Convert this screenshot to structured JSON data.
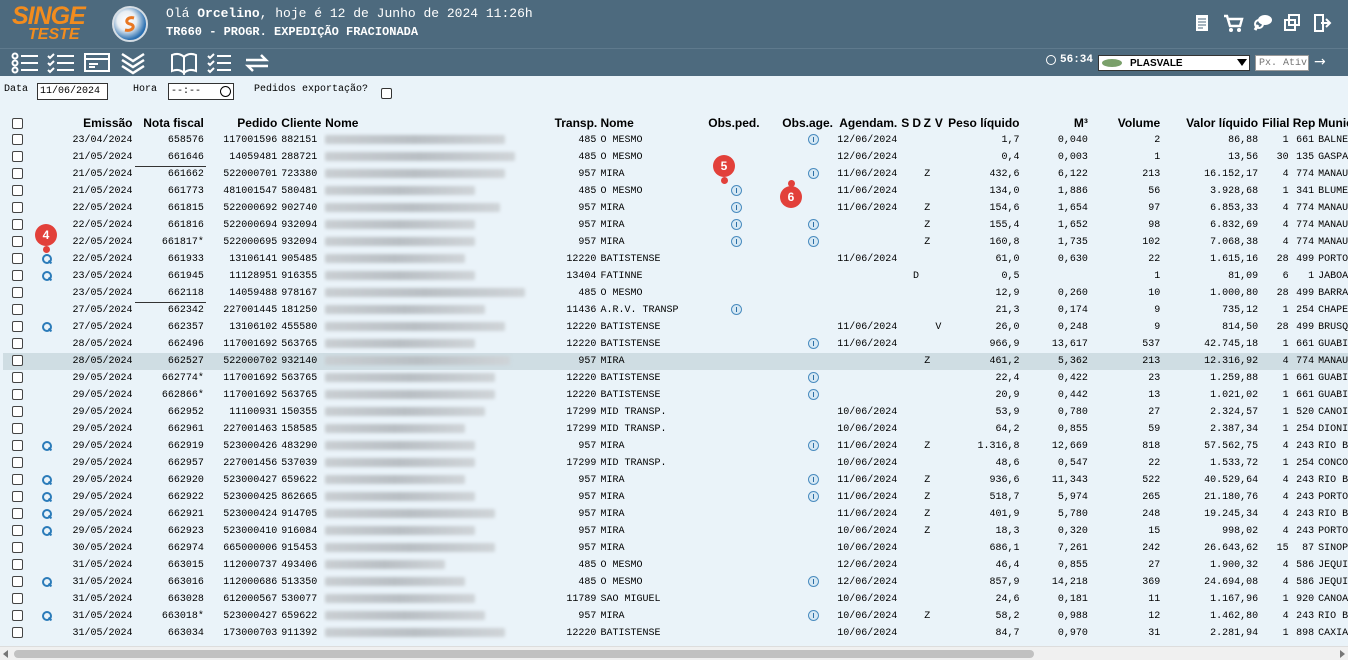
{
  "header": {
    "logo_line1": "SINGE",
    "logo_line2": "TESTE",
    "greeting_prefix": "Olá ",
    "user": "Orcelino",
    "greeting_suffix": ", hoje é 12 de Junho de 2024 11:26h",
    "title": "TR660 - PROGR. EXPEDIÇÃO FRACIONADA",
    "icons": [
      "report-icon",
      "cart-icon",
      "chat-icon",
      "window-icon",
      "exit-icon"
    ]
  },
  "toolbar": {
    "icons": [
      "list-icon",
      "checklist-icon",
      "card-icon",
      "collapse-icon",
      "book-icon",
      "tasks-icon",
      "refresh-icon"
    ],
    "timer": "56:34",
    "company": "PLASVALE",
    "next_placeholder": "Px. Ativ"
  },
  "filters": {
    "date_label": "Data",
    "date_value": "11/06/2024",
    "hour_label": "Hora",
    "hour_value": "--:--",
    "export_label": "Pedidos exportação?"
  },
  "columns": {
    "emissao": "Emissão",
    "nf": "Nota fiscal",
    "pedido": "Pedido",
    "cliente": "Cliente",
    "nome": "Nome",
    "transp": "Transp.",
    "transp_nome": "Nome",
    "obs_ped": "Obs.ped.",
    "obs_age": "Obs.age.",
    "agendam": "Agendam.",
    "s": "S",
    "d": "D",
    "z": "Z",
    "v": "V",
    "peso": "Peso líquido",
    "m3": "M³",
    "volume": "Volume",
    "valor": "Valor líquido",
    "filial": "Filial",
    "rep": "Rep",
    "munic": "Munic"
  },
  "rows": [
    {
      "mag": false,
      "emissao": "23/04/2024",
      "nf": "658576",
      "pedido": "117001596",
      "cliente": "882151",
      "transp": "485",
      "tnome": "O MESMO",
      "obs_ped": false,
      "obs_age": true,
      "agend": "12/06/2024",
      "s": "",
      "d": "",
      "z": "",
      "v": "",
      "peso": "1,7",
      "m3": "0,040",
      "vol": "2",
      "valor": "86,88",
      "filial": "1",
      "rep": "661",
      "munic": "BALNE"
    },
    {
      "mag": false,
      "emissao": "21/05/2024",
      "nf": "661646",
      "pedido": "14059481",
      "cliente": "288721",
      "transp": "485",
      "tnome": "O MESMO",
      "obs_ped": false,
      "obs_age": false,
      "agend": "12/06/2024",
      "s": "",
      "d": "",
      "z": "",
      "v": "",
      "peso": "0,4",
      "m3": "0,003",
      "vol": "1",
      "valor": "13,56",
      "filial": "30",
      "rep": "135",
      "munic": "GASPA"
    },
    {
      "mag": false,
      "emissao": "21/05/2024",
      "nf": "661662",
      "pedido": "522000701",
      "cliente": "723380",
      "transp": "957",
      "tnome": "MIRA",
      "obs_ped": false,
      "obs_age": true,
      "agend": "11/06/2024",
      "s": "",
      "d": "",
      "z": "Z",
      "v": "",
      "peso": "432,6",
      "m3": "6,122",
      "vol": "213",
      "valor": "16.152,17",
      "filial": "4",
      "rep": "774",
      "munic": "MANAU"
    },
    {
      "mag": false,
      "emissao": "21/05/2024",
      "nf": "661773",
      "pedido": "481001547",
      "cliente": "580481",
      "transp": "485",
      "tnome": "O MESMO",
      "obs_ped": true,
      "obs_age": false,
      "agend": "11/06/2024",
      "s": "",
      "d": "",
      "z": "",
      "v": "",
      "peso": "134,0",
      "m3": "1,886",
      "vol": "56",
      "valor": "3.928,68",
      "filial": "1",
      "rep": "341",
      "munic": "BLUME"
    },
    {
      "mag": false,
      "emissao": "22/05/2024",
      "nf": "661815",
      "pedido": "522000692",
      "cliente": "902740",
      "transp": "957",
      "tnome": "MIRA",
      "obs_ped": true,
      "obs_age": false,
      "agend": "11/06/2024",
      "s": "",
      "d": "",
      "z": "Z",
      "v": "",
      "peso": "154,6",
      "m3": "1,654",
      "vol": "97",
      "valor": "6.853,33",
      "filial": "4",
      "rep": "774",
      "munic": "MANAU"
    },
    {
      "mag": false,
      "emissao": "22/05/2024",
      "nf": "661816",
      "pedido": "522000694",
      "cliente": "932094",
      "transp": "957",
      "tnome": "MIRA",
      "obs_ped": true,
      "obs_age": true,
      "agend": "",
      "s": "",
      "d": "",
      "z": "Z",
      "v": "",
      "peso": "155,4",
      "m3": "1,652",
      "vol": "98",
      "valor": "6.832,69",
      "filial": "4",
      "rep": "774",
      "munic": "MANAU"
    },
    {
      "mag": false,
      "emissao": "22/05/2024",
      "nf": "661817*",
      "pedido": "522000695",
      "cliente": "932094",
      "transp": "957",
      "tnome": "MIRA",
      "obs_ped": true,
      "obs_age": true,
      "agend": "",
      "s": "",
      "d": "",
      "z": "Z",
      "v": "",
      "peso": "160,8",
      "m3": "1,735",
      "vol": "102",
      "valor": "7.068,38",
      "filial": "4",
      "rep": "774",
      "munic": "MANAU"
    },
    {
      "mag": true,
      "emissao": "22/05/2024",
      "nf": "661933",
      "pedido": "13106141",
      "cliente": "905485",
      "transp": "12220",
      "tnome": "BATISTENSE",
      "obs_ped": false,
      "obs_age": false,
      "agend": "11/06/2024",
      "s": "",
      "d": "",
      "z": "",
      "v": "",
      "peso": "61,0",
      "m3": "0,630",
      "vol": "22",
      "valor": "1.615,16",
      "filial": "28",
      "rep": "499",
      "munic": "PORTO"
    },
    {
      "mag": true,
      "emissao": "23/05/2024",
      "nf": "661945",
      "pedido": "11128951",
      "cliente": "916355",
      "transp": "13404",
      "tnome": "FATINNE",
      "obs_ped": false,
      "obs_age": false,
      "agend": "",
      "s": "",
      "d": "D",
      "z": "",
      "v": "",
      "peso": "0,5",
      "m3": "",
      "vol": "1",
      "valor": "81,09",
      "filial": "6",
      "rep": "1",
      "munic": "JABOA"
    },
    {
      "mag": false,
      "emissao": "23/05/2024",
      "nf": "662118",
      "pedido": "14059488",
      "cliente": "978167",
      "transp": "485",
      "tnome": "O MESMO",
      "obs_ped": false,
      "obs_age": false,
      "agend": "",
      "s": "",
      "d": "",
      "z": "",
      "v": "",
      "peso": "12,9",
      "m3": "0,260",
      "vol": "10",
      "valor": "1.000,80",
      "filial": "28",
      "rep": "499",
      "munic": "BARRA"
    },
    {
      "mag": false,
      "emissao": "27/05/2024",
      "nf": "662342",
      "pedido": "227001445",
      "cliente": "181250",
      "transp": "11436",
      "tnome": "A.R.V. TRANSP",
      "obs_ped": true,
      "obs_age": false,
      "agend": "",
      "s": "",
      "d": "",
      "z": "",
      "v": "",
      "peso": "21,3",
      "m3": "0,174",
      "vol": "9",
      "valor": "735,12",
      "filial": "1",
      "rep": "254",
      "munic": "CHAPE"
    },
    {
      "mag": true,
      "emissao": "27/05/2024",
      "nf": "662357",
      "pedido": "13106102",
      "cliente": "455580",
      "transp": "12220",
      "tnome": "BATISTENSE",
      "obs_ped": false,
      "obs_age": false,
      "agend": "11/06/2024",
      "s": "",
      "d": "",
      "z": "",
      "v": "V",
      "peso": "26,0",
      "m3": "0,248",
      "vol": "9",
      "valor": "814,50",
      "filial": "28",
      "rep": "499",
      "munic": "BRUSQ"
    },
    {
      "mag": false,
      "emissao": "28/05/2024",
      "nf": "662496",
      "pedido": "117001692",
      "cliente": "563765",
      "transp": "12220",
      "tnome": "BATISTENSE",
      "obs_ped": false,
      "obs_age": true,
      "agend": "11/06/2024",
      "s": "",
      "d": "",
      "z": "",
      "v": "",
      "peso": "966,9",
      "m3": "13,617",
      "vol": "537",
      "valor": "42.745,18",
      "filial": "1",
      "rep": "661",
      "munic": "GUABI"
    },
    {
      "mag": false,
      "sel": true,
      "emissao": "28/05/2024",
      "nf": "662527",
      "pedido": "522000702",
      "cliente": "932140",
      "transp": "957",
      "tnome": "MIRA",
      "obs_ped": false,
      "obs_age": false,
      "agend": "",
      "s": "",
      "d": "",
      "z": "Z",
      "v": "",
      "peso": "461,2",
      "m3": "5,362",
      "vol": "213",
      "valor": "12.316,92",
      "filial": "4",
      "rep": "774",
      "munic": "MANAU"
    },
    {
      "mag": false,
      "emissao": "29/05/2024",
      "nf": "662774*",
      "pedido": "117001692",
      "cliente": "563765",
      "transp": "12220",
      "tnome": "BATISTENSE",
      "obs_ped": false,
      "obs_age": true,
      "agend": "",
      "s": "",
      "d": "",
      "z": "",
      "v": "",
      "peso": "22,4",
      "m3": "0,422",
      "vol": "23",
      "valor": "1.259,88",
      "filial": "1",
      "rep": "661",
      "munic": "GUABI"
    },
    {
      "mag": false,
      "emissao": "29/05/2024",
      "nf": "662866*",
      "pedido": "117001692",
      "cliente": "563765",
      "transp": "12220",
      "tnome": "BATISTENSE",
      "obs_ped": false,
      "obs_age": true,
      "agend": "",
      "s": "",
      "d": "",
      "z": "",
      "v": "",
      "peso": "20,9",
      "m3": "0,442",
      "vol": "13",
      "valor": "1.021,02",
      "filial": "1",
      "rep": "661",
      "munic": "GUABI"
    },
    {
      "mag": false,
      "emissao": "29/05/2024",
      "nf": "662952",
      "pedido": "11100931",
      "cliente": "150355",
      "transp": "17299",
      "tnome": "MID TRANSP.",
      "obs_ped": false,
      "obs_age": false,
      "agend": "10/06/2024",
      "s": "",
      "d": "",
      "z": "",
      "v": "",
      "peso": "53,9",
      "m3": "0,780",
      "vol": "27",
      "valor": "2.324,57",
      "filial": "1",
      "rep": "520",
      "munic": "CANOI"
    },
    {
      "mag": false,
      "emissao": "29/05/2024",
      "nf": "662961",
      "pedido": "227001463",
      "cliente": "158585",
      "transp": "17299",
      "tnome": "MID TRANSP.",
      "obs_ped": false,
      "obs_age": false,
      "agend": "10/06/2024",
      "s": "",
      "d": "",
      "z": "",
      "v": "",
      "peso": "64,2",
      "m3": "0,855",
      "vol": "59",
      "valor": "2.387,34",
      "filial": "1",
      "rep": "254",
      "munic": "DIONI"
    },
    {
      "mag": true,
      "emissao": "29/05/2024",
      "nf": "662919",
      "pedido": "523000426",
      "cliente": "483290",
      "transp": "957",
      "tnome": "MIRA",
      "obs_ped": false,
      "obs_age": true,
      "agend": "11/06/2024",
      "s": "",
      "d": "",
      "z": "Z",
      "v": "",
      "peso": "1.316,8",
      "m3": "12,669",
      "vol": "818",
      "valor": "57.562,75",
      "filial": "4",
      "rep": "243",
      "munic": "RIO B"
    },
    {
      "mag": false,
      "emissao": "29/05/2024",
      "nf": "662957",
      "pedido": "227001456",
      "cliente": "537039",
      "transp": "17299",
      "tnome": "MID TRANSP.",
      "obs_ped": false,
      "obs_age": false,
      "agend": "10/06/2024",
      "s": "",
      "d": "",
      "z": "",
      "v": "",
      "peso": "48,6",
      "m3": "0,547",
      "vol": "22",
      "valor": "1.533,72",
      "filial": "1",
      "rep": "254",
      "munic": "CONCO"
    },
    {
      "mag": true,
      "emissao": "29/05/2024",
      "nf": "662920",
      "pedido": "523000427",
      "cliente": "659622",
      "transp": "957",
      "tnome": "MIRA",
      "obs_ped": false,
      "obs_age": true,
      "agend": "11/06/2024",
      "s": "",
      "d": "",
      "z": "Z",
      "v": "",
      "peso": "936,6",
      "m3": "11,343",
      "vol": "522",
      "valor": "40.529,64",
      "filial": "4",
      "rep": "243",
      "munic": "RIO B"
    },
    {
      "mag": true,
      "emissao": "29/05/2024",
      "nf": "662922",
      "pedido": "523000425",
      "cliente": "862665",
      "transp": "957",
      "tnome": "MIRA",
      "obs_ped": false,
      "obs_age": true,
      "agend": "11/06/2024",
      "s": "",
      "d": "",
      "z": "Z",
      "v": "",
      "peso": "518,7",
      "m3": "5,974",
      "vol": "265",
      "valor": "21.180,76",
      "filial": "4",
      "rep": "243",
      "munic": "PORTO"
    },
    {
      "mag": true,
      "emissao": "29/05/2024",
      "nf": "662921",
      "pedido": "523000424",
      "cliente": "914705",
      "transp": "957",
      "tnome": "MIRA",
      "obs_ped": false,
      "obs_age": false,
      "agend": "11/06/2024",
      "s": "",
      "d": "",
      "z": "Z",
      "v": "",
      "peso": "401,9",
      "m3": "5,780",
      "vol": "248",
      "valor": "19.245,34",
      "filial": "4",
      "rep": "243",
      "munic": "RIO B"
    },
    {
      "mag": true,
      "emissao": "29/05/2024",
      "nf": "662923",
      "pedido": "523000410",
      "cliente": "916084",
      "transp": "957",
      "tnome": "MIRA",
      "obs_ped": false,
      "obs_age": false,
      "agend": "10/06/2024",
      "s": "",
      "d": "",
      "z": "Z",
      "v": "",
      "peso": "18,3",
      "m3": "0,320",
      "vol": "15",
      "valor": "998,02",
      "filial": "4",
      "rep": "243",
      "munic": "PORTO"
    },
    {
      "mag": false,
      "emissao": "30/05/2024",
      "nf": "662974",
      "pedido": "665000006",
      "cliente": "915453",
      "transp": "957",
      "tnome": "MIRA",
      "obs_ped": false,
      "obs_age": false,
      "agend": "10/06/2024",
      "s": "",
      "d": "",
      "z": "",
      "v": "",
      "peso": "686,1",
      "m3": "7,261",
      "vol": "242",
      "valor": "26.643,62",
      "filial": "15",
      "rep": "87",
      "munic": "SINOP"
    },
    {
      "mag": false,
      "emissao": "31/05/2024",
      "nf": "663015",
      "pedido": "112000737",
      "cliente": "493406",
      "transp": "485",
      "tnome": "O MESMO",
      "obs_ped": false,
      "obs_age": false,
      "agend": "12/06/2024",
      "s": "",
      "d": "",
      "z": "",
      "v": "",
      "peso": "46,4",
      "m3": "0,855",
      "vol": "27",
      "valor": "1.900,32",
      "filial": "4",
      "rep": "586",
      "munic": "JEQUI"
    },
    {
      "mag": true,
      "emissao": "31/05/2024",
      "nf": "663016",
      "pedido": "112000686",
      "cliente": "513350",
      "transp": "485",
      "tnome": "O MESMO",
      "obs_ped": false,
      "obs_age": true,
      "agend": "12/06/2024",
      "s": "",
      "d": "",
      "z": "",
      "v": "",
      "peso": "857,9",
      "m3": "14,218",
      "vol": "369",
      "valor": "24.694,08",
      "filial": "4",
      "rep": "586",
      "munic": "JEQUI"
    },
    {
      "mag": false,
      "emissao": "31/05/2024",
      "nf": "663028",
      "pedido": "612000567",
      "cliente": "530077",
      "transp": "11789",
      "tnome": "SAO MIGUEL",
      "obs_ped": false,
      "obs_age": false,
      "agend": "10/06/2024",
      "s": "",
      "d": "",
      "z": "",
      "v": "",
      "peso": "24,6",
      "m3": "0,181",
      "vol": "11",
      "valor": "1.167,96",
      "filial": "1",
      "rep": "920",
      "munic": "CANOA"
    },
    {
      "mag": true,
      "emissao": "31/05/2024",
      "nf": "663018*",
      "pedido": "523000427",
      "cliente": "659622",
      "transp": "957",
      "tnome": "MIRA",
      "obs_ped": false,
      "obs_age": true,
      "agend": "10/06/2024",
      "s": "",
      "d": "",
      "z": "Z",
      "v": "",
      "peso": "58,2",
      "m3": "0,988",
      "vol": "12",
      "valor": "1.462,80",
      "filial": "4",
      "rep": "243",
      "munic": "RIO B"
    },
    {
      "mag": false,
      "emissao": "31/05/2024",
      "nf": "663034",
      "pedido": "173000703",
      "cliente": "911392",
      "transp": "12220",
      "tnome": "BATISTENSE",
      "obs_ped": false,
      "obs_age": false,
      "agend": "10/06/2024",
      "s": "",
      "d": "",
      "z": "",
      "v": "",
      "peso": "84,7",
      "m3": "0,970",
      "vol": "31",
      "valor": "2.281,94",
      "filial": "1",
      "rep": "898",
      "munic": "CAXIA"
    }
  ],
  "callouts": [
    "4",
    "5",
    "6"
  ]
}
